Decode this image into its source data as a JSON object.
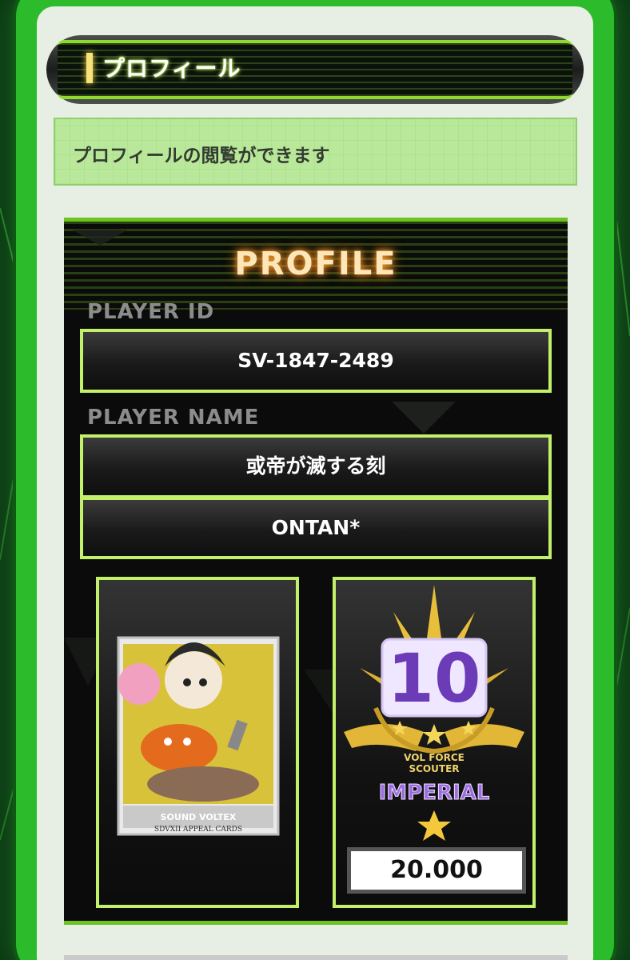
{
  "header": {
    "title": "プロフィール"
  },
  "notice": {
    "text": "プロフィールの閲覧ができます"
  },
  "profile": {
    "title": "PROFILE",
    "player_id_label": "PLAYER ID",
    "player_id": "SV-1847-2489",
    "player_name_label": "PLAYER NAME",
    "title_text": "或帝が滅する刻",
    "player_name": "ONTAN*",
    "appeal_card": {
      "brand": "SOUND VOLTEX",
      "footer": "SDVXII APPEAL CARDS"
    },
    "volforce": {
      "rank_number": "10",
      "caption_top": "VOL FORCE",
      "caption_bottom": "SCOUTER",
      "class_name": "IMPERIAL",
      "value": "20.000",
      "star_icon": "star-icon"
    }
  },
  "colors": {
    "frame_green": "#2bbb2b",
    "border_lime": "#c3f06a",
    "notice_bg": "#b9e89b",
    "panel_bg": "#e7efe4",
    "rank_purple": "#6b3bb8",
    "gold": "#e7bf3a"
  }
}
